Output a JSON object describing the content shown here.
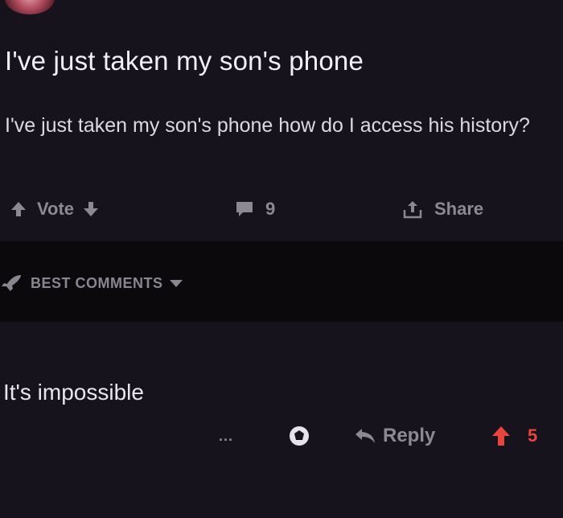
{
  "post": {
    "title": "I've just taken my son's phone",
    "body": "I've just taken my son's phone how do I access his history?",
    "actions": {
      "vote_label": "Vote",
      "comment_count": "9",
      "share_label": "Share"
    }
  },
  "comments_header": {
    "sort_label": "BEST COMMENTS"
  },
  "comment": {
    "text": "It's impossible",
    "more_label": "...",
    "reply_label": "Reply",
    "score": "5"
  },
  "colors": {
    "background": "#16121c",
    "divider": "#0c090d",
    "muted_text": "#8d8994",
    "upvote_active": "#e8453c"
  },
  "icons": [
    "avatar",
    "upvote-icon",
    "downvote-icon",
    "comment-icon",
    "share-icon",
    "rocket-icon",
    "caret-down-icon",
    "award-icon",
    "reply-icon"
  ]
}
